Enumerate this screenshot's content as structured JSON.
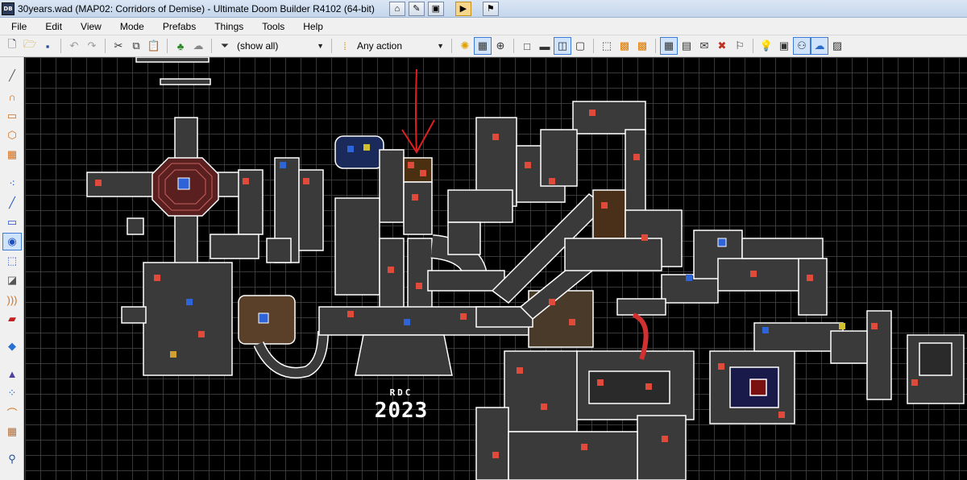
{
  "window": {
    "title": "30years.wad (MAP02: Corridors of Demise) - Ultimate Doom Builder R4102 (64-bit)",
    "app_icon_text": "DB"
  },
  "menu": [
    "File",
    "Edit",
    "View",
    "Mode",
    "Prefabs",
    "Things",
    "Tools",
    "Help"
  ],
  "toolbar": {
    "filter_value": "(show all)",
    "action_value": "Any action"
  },
  "map": {
    "watermark_top": "RDC",
    "watermark_bottom": "2023",
    "marker_color": "#e02020"
  },
  "colors": {
    "linedef": "#ffffff",
    "sector_fill": "#3a3a3a",
    "thing_red": "#e04a3a",
    "thing_blue": "#2f63d8"
  }
}
